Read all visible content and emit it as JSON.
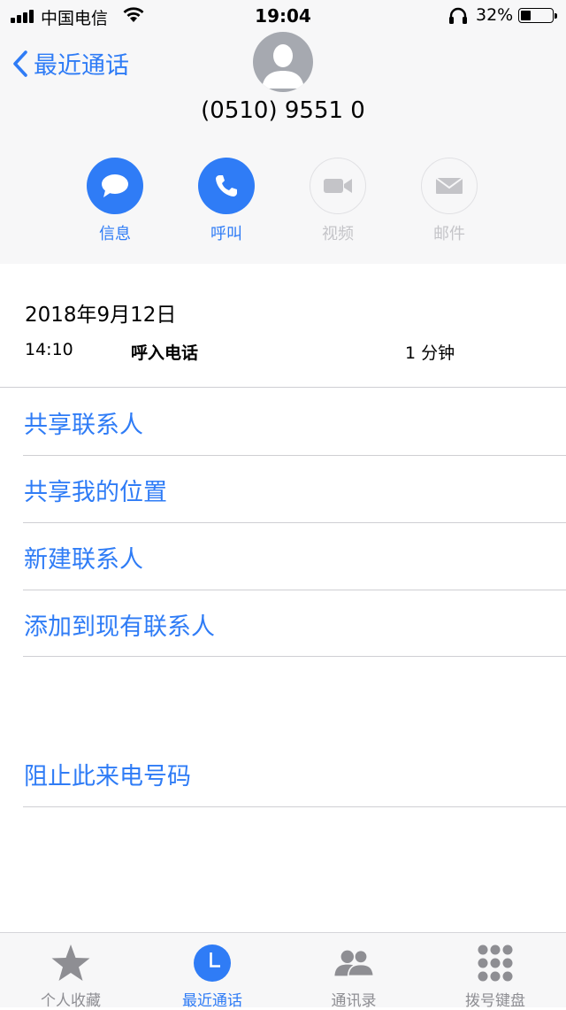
{
  "status_bar": {
    "carrier": "中国电信",
    "time": "19:04",
    "battery_percent": "32%",
    "battery_level": 0.32
  },
  "nav": {
    "back_label": "最近通话"
  },
  "contact": {
    "number": "(0510) 9551 0"
  },
  "actions": [
    {
      "label": "信息",
      "icon": "message-icon",
      "enabled": true
    },
    {
      "label": "呼叫",
      "icon": "phone-icon",
      "enabled": true
    },
    {
      "label": "视频",
      "icon": "video-icon",
      "enabled": false
    },
    {
      "label": "邮件",
      "icon": "mail-icon",
      "enabled": false
    }
  ],
  "call_log": {
    "date": "2018年9月12日",
    "time": "14:10",
    "type": "呼入电话",
    "duration": "1 分钟"
  },
  "menu": [
    "共享联系人",
    "共享我的位置",
    "新建联系人",
    "添加到现有联系人"
  ],
  "block_label": "阻止此来电号码",
  "tabbar": [
    {
      "label": "个人收藏",
      "icon": "star-icon",
      "active": false
    },
    {
      "label": "最近通话",
      "icon": "clock-icon",
      "active": true
    },
    {
      "label": "通讯录",
      "icon": "contacts-icon",
      "active": false
    },
    {
      "label": "拨号键盘",
      "icon": "keypad-icon",
      "active": false
    }
  ],
  "colors": {
    "accent": "#2f7cf6",
    "disabled": "#c4c4c8",
    "header_bg": "#f7f7f8"
  }
}
